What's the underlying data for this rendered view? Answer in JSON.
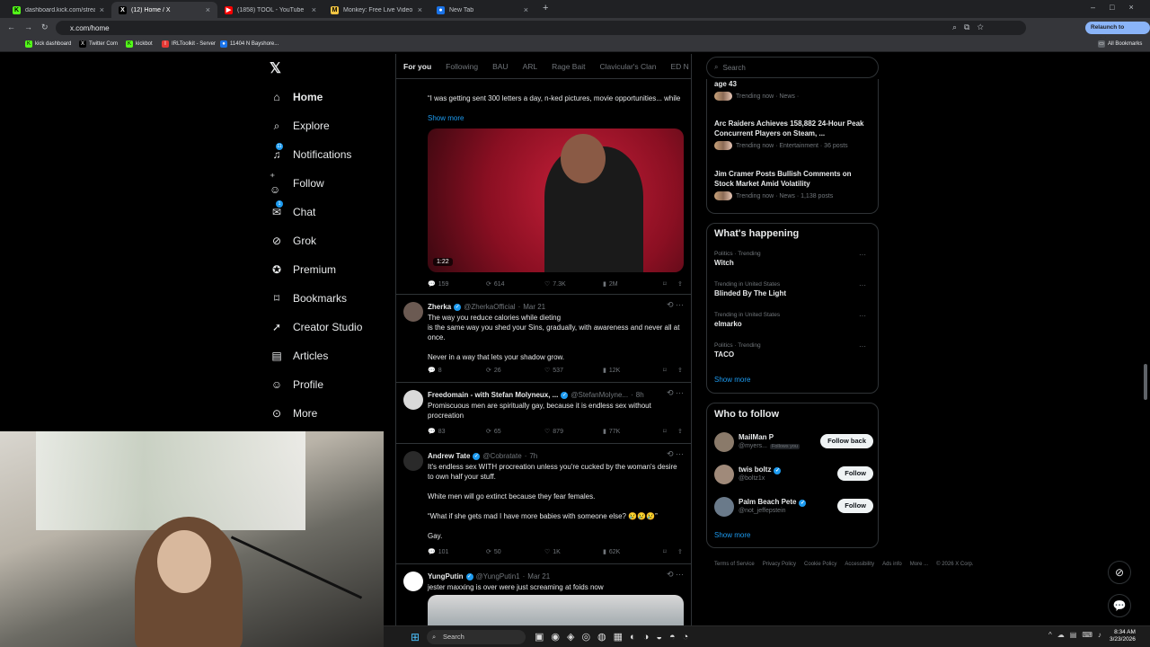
{
  "browser": {
    "tabs": [
      {
        "label": "dashboard.kick.com/stream",
        "active": false
      },
      {
        "label": "(12) Home / X",
        "active": true
      },
      {
        "label": "(1858) TOOL - YouTube",
        "active": false
      },
      {
        "label": "Monkey: Free Live Video Ch",
        "active": false
      },
      {
        "label": "New Tab",
        "active": false
      }
    ],
    "url": "x.com/home",
    "relaunch_label": "Relaunch to update",
    "bookmarks": [
      "kick dashboard",
      "Twitter Com",
      "kickbot",
      "IRLToolkit - Server",
      "11404 N Bayshore..."
    ],
    "all_bookmarks": "All Bookmarks"
  },
  "nav": {
    "items": [
      {
        "label": "Home",
        "icon": "home-icon"
      },
      {
        "label": "Explore",
        "icon": "search-icon"
      },
      {
        "label": "Notifications",
        "icon": "bell-icon",
        "badge": "11"
      },
      {
        "label": "Follow",
        "icon": "person-plus-icon"
      },
      {
        "label": "Chat",
        "icon": "mail-icon",
        "badge": "1"
      },
      {
        "label": "Grok",
        "icon": "grok-icon"
      },
      {
        "label": "Premium",
        "icon": "premium-icon"
      },
      {
        "label": "Bookmarks",
        "icon": "bookmark-icon"
      },
      {
        "label": "Creator Studio",
        "icon": "rocket-icon"
      },
      {
        "label": "Articles",
        "icon": "article-icon"
      },
      {
        "label": "Profile",
        "icon": "person-icon"
      },
      {
        "label": "More",
        "icon": "more-circle-icon"
      }
    ]
  },
  "feed": {
    "tabs": [
      "For you",
      "Following",
      "BAU",
      "ARL",
      "Rage Bait",
      "Clavicular's Clan",
      "ED N"
    ],
    "tweet0": {
      "text": "“I was getting sent 300 letters a day, n-ked pictures, movie opportunities... while",
      "show_more": "Show more",
      "duration": "1:22",
      "replies": "159",
      "reposts": "614",
      "likes": "7.3K",
      "views": "2M"
    },
    "tweets": [
      {
        "name": "Zherka",
        "handle": "@ZherkaOfficial",
        "time": "Mar 21",
        "text": "The way you reduce calories while dieting\nis the same way you shed your Sins, gradually, with awareness and never all at once.\n\nNever in a way that lets your shadow grow.",
        "replies": "8",
        "reposts": "26",
        "likes": "537",
        "views": "12K"
      },
      {
        "name": "Freedomain - with Stefan Molyneux, ...",
        "handle": "@StefanMolyne...",
        "time": "8h",
        "text": "Promiscuous men are spiritually gay, because it is endless sex without procreation",
        "replies": "83",
        "reposts": "65",
        "likes": "879",
        "views": "77K"
      },
      {
        "name": "Andrew Tate",
        "handle": "@Cobratate",
        "time": "7h",
        "text": "It's endless sex WITH procreation unless you're cucked by the woman's desire to own half your stuff.\n\nWhite men will go extinct because they fear females.\n\n“What if she gets mad I have more babies with someone else? 😢😢😢”\n\nGay.",
        "replies": "101",
        "reposts": "50",
        "likes": "1K",
        "views": "62K"
      },
      {
        "name": "YungPutin",
        "handle": "@YungPutin1",
        "time": "Mar 21",
        "text": "jester maxxing is over were just screaming at foids now",
        "replies": "",
        "reposts": "",
        "likes": "",
        "views": ""
      }
    ]
  },
  "right": {
    "search_placeholder": "Search",
    "trending_top": [
      {
        "title": "age 43",
        "meta": "Trending now · News ·"
      },
      {
        "title": "Arc Raiders Achieves 158,882 24-Hour Peak Concurrent Players on Steam, ...",
        "meta": "Trending now · Entertainment · 36 posts"
      },
      {
        "title": "Jim Cramer Posts Bullish Comments on Stock Market Amid Volatility",
        "meta": "Trending now · News · 1,138 posts"
      }
    ],
    "happening_title": "What's happening",
    "happening": [
      {
        "context": "Politics · Trending",
        "topic": "Witch"
      },
      {
        "context": "Trending in United States",
        "topic": "Blinded By The Light"
      },
      {
        "context": "Trending in United States",
        "topic": "elmarko"
      },
      {
        "context": "Politics · Trending",
        "topic": "TACO"
      }
    ],
    "show_more": "Show more",
    "wtf_title": "Who to follow",
    "wtf": [
      {
        "name": "MailMan P",
        "handle": "@myers...",
        "follows_you": "Follows you",
        "button": "Follow back"
      },
      {
        "name": "twis boltz",
        "handle": "@boltz1x",
        "follows_you": "",
        "button": "Follow"
      },
      {
        "name": "Palm Beach Pete",
        "handle": "@not_jeffepstein",
        "follows_you": "",
        "button": "Follow"
      }
    ],
    "footer": [
      "Terms of Service",
      "Privacy Policy",
      "Cookie Policy",
      "Accessibility",
      "Ads info",
      "More ...",
      "© 2026 X Corp."
    ]
  },
  "taskbar": {
    "search": "Search",
    "time": "8:34 AM",
    "date": "3/23/2026"
  },
  "colors": {
    "accent": "#1d9bf0",
    "border": "#2f3336",
    "muted": "#71767b",
    "text": "#e7e9ea"
  }
}
